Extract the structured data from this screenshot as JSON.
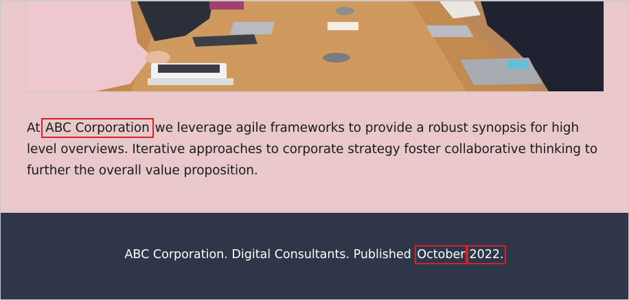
{
  "article": {
    "intro_prefix": "At ",
    "company_name": "ABC Corporation",
    "intro_suffix": " we leverage agile frameworks to provide a robust synopsis for high level overviews. Iterative approaches to corporate strategy foster collaborative thinking to further the overall value proposition."
  },
  "footer": {
    "text_prefix": "ABC Corporation. Digital Consultants. Published ",
    "month": "October",
    "year": "2022."
  },
  "colors": {
    "page_bg": "#e8c8cb",
    "footer_bg": "#2e3749",
    "highlight": "#d61f26"
  }
}
